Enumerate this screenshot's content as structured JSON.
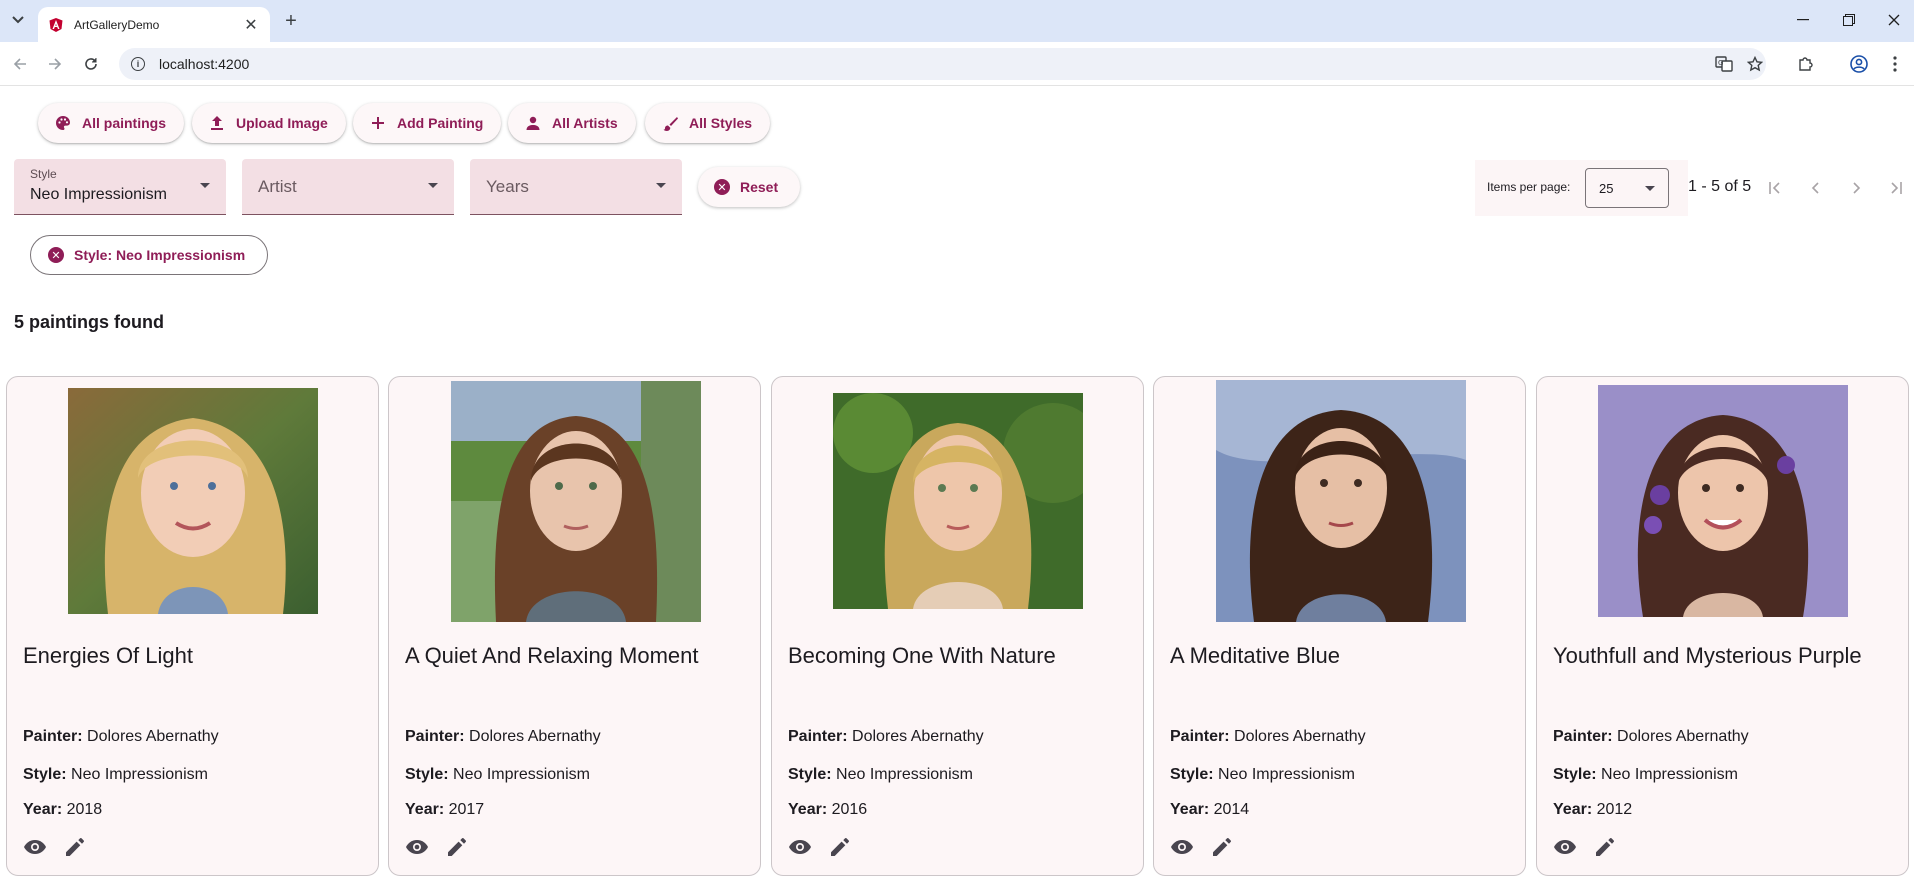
{
  "browser": {
    "tab_title": "ArtGalleryDemo",
    "url": "localhost:4200"
  },
  "toolbar": {
    "buttons": [
      {
        "label": "All paintings",
        "icon": "palette-icon"
      },
      {
        "label": "Upload Image",
        "icon": "upload-icon"
      },
      {
        "label": "Add Painting",
        "icon": "plus-icon"
      },
      {
        "label": "All Artists",
        "icon": "person-icon"
      },
      {
        "label": "All Styles",
        "icon": "brush-icon"
      }
    ]
  },
  "filters": {
    "style": {
      "label": "Style",
      "value": "Neo Impressionism"
    },
    "artist": {
      "placeholder": "Artist"
    },
    "years": {
      "placeholder": "Years"
    },
    "reset_label": "Reset",
    "active_chip": "Style: Neo Impressionism"
  },
  "paginator": {
    "items_per_page_label": "Items per page:",
    "items_per_page": "25",
    "range": "1 - 5 of 5"
  },
  "results": {
    "count_text": "5 paintings found"
  },
  "labels": {
    "painter": "Painter:",
    "style": "Style:",
    "year": "Year:"
  },
  "colors": {
    "primary": "#8f1d57",
    "field_bg": "#f3dfe4",
    "card_bg": "#fdf6f7"
  },
  "paintings": [
    {
      "title": "Energies Of Light",
      "painter": "Dolores Abernathy",
      "style": "Neo Impressionism",
      "year": "2018"
    },
    {
      "title": "A Quiet And Relaxing Moment",
      "painter": "Dolores Abernathy",
      "style": "Neo Impressionism",
      "year": "2017"
    },
    {
      "title": "Becoming One With Nature",
      "painter": "Dolores Abernathy",
      "style": "Neo Impressionism",
      "year": "2016"
    },
    {
      "title": "A Meditative Blue",
      "painter": "Dolores Abernathy",
      "style": "Neo Impressionism",
      "year": "2014"
    },
    {
      "title": "Youthfull and Mysterious Purple",
      "painter": "Dolores Abernathy",
      "style": "Neo Impressionism",
      "year": "2012"
    }
  ]
}
